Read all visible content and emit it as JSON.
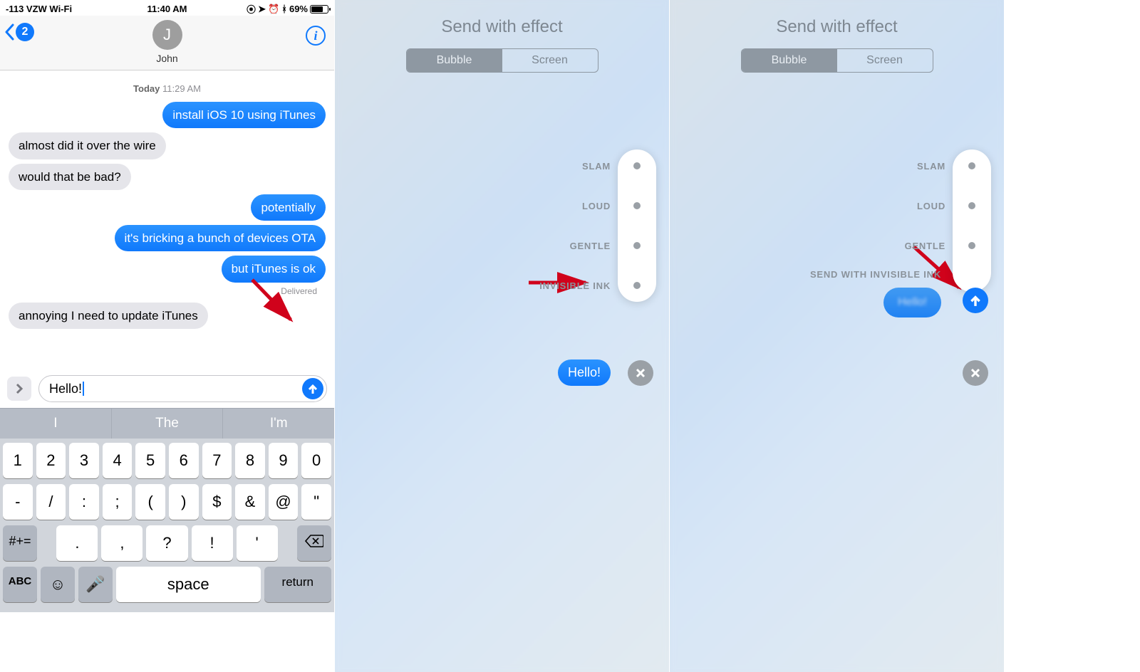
{
  "status": {
    "left": "-113 VZW Wi-Fi",
    "time": "11:40 AM",
    "battery_pct": "69%"
  },
  "header": {
    "back_count": "2",
    "avatar_initial": "J",
    "contact": "John"
  },
  "timestamp": {
    "day": "Today",
    "time": "11:29 AM"
  },
  "messages": [
    {
      "dir": "out",
      "text": "install iOS 10 using iTunes"
    },
    {
      "dir": "in",
      "text": "almost did it over the wire"
    },
    {
      "dir": "in",
      "text": "would that be bad?"
    },
    {
      "dir": "out",
      "text": "potentially"
    },
    {
      "dir": "out",
      "text": "it's bricking a bunch of devices OTA"
    },
    {
      "dir": "out",
      "text": "but iTunes is ok"
    }
  ],
  "delivered_label": "Delivered",
  "messages2": [
    {
      "dir": "in",
      "text": "annoying I need to update iTunes"
    }
  ],
  "compose": {
    "text": "Hello!"
  },
  "predictive": [
    "I",
    "The",
    "I'm"
  ],
  "keyboard": {
    "r1": [
      "1",
      "2",
      "3",
      "4",
      "5",
      "6",
      "7",
      "8",
      "9",
      "0"
    ],
    "r2": [
      "-",
      "/",
      ":",
      ";",
      "(",
      ")",
      "$",
      "&",
      "@",
      "\""
    ],
    "r3_shift": "#+=",
    "r3": [
      ".",
      ",",
      "?",
      "!",
      "'"
    ],
    "r4_abc": "ABC",
    "r4_space": "space",
    "r4_return": "return"
  },
  "effects": {
    "title": "Send with effect",
    "tab_bubble": "Bubble",
    "tab_screen": "Screen",
    "labels": [
      "SLAM",
      "LOUD",
      "GENTLE",
      "INVISIBLE INK"
    ],
    "hello": "Hello!",
    "inv_title": "SEND WITH INVISIBLE INK",
    "inv_preview": "Hello!"
  }
}
